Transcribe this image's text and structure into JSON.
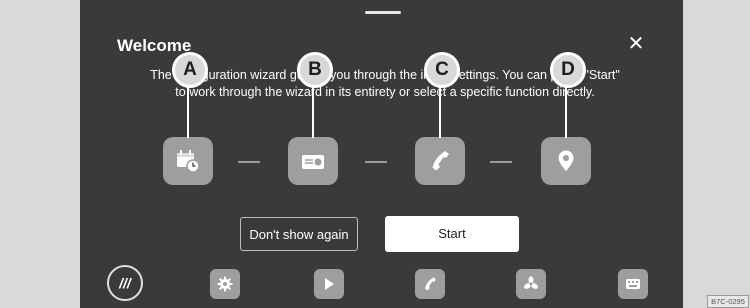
{
  "dialog": {
    "title": "Welcome",
    "close_glyph": "✕",
    "description": "The configuration wizard guides you through the initial settings. You can press \"Start\" to work through the wizard in its entirety or select a specific function directly."
  },
  "steps": [
    {
      "marker": "A",
      "icon": "calendar-clock-icon"
    },
    {
      "marker": "B",
      "icon": "radio-icon"
    },
    {
      "marker": "C",
      "icon": "phone-icon"
    },
    {
      "marker": "D",
      "icon": "location-pin-icon"
    }
  ],
  "buttons": {
    "dont_show_again": "Don't show again",
    "start": "Start"
  },
  "dock": {
    "menu_glyph": "///",
    "items": [
      "settings-gear-icon",
      "media-play-icon",
      "phone-icon",
      "fan-icon",
      "keyboard-icon"
    ]
  },
  "figure_code": "B7C-0295",
  "colors": {
    "screen_bg": "#3a3a3a",
    "icon_tile": "#9e9e9e",
    "marker_fill": "#d8d8d8",
    "page_bg": "#d9d9d9"
  }
}
